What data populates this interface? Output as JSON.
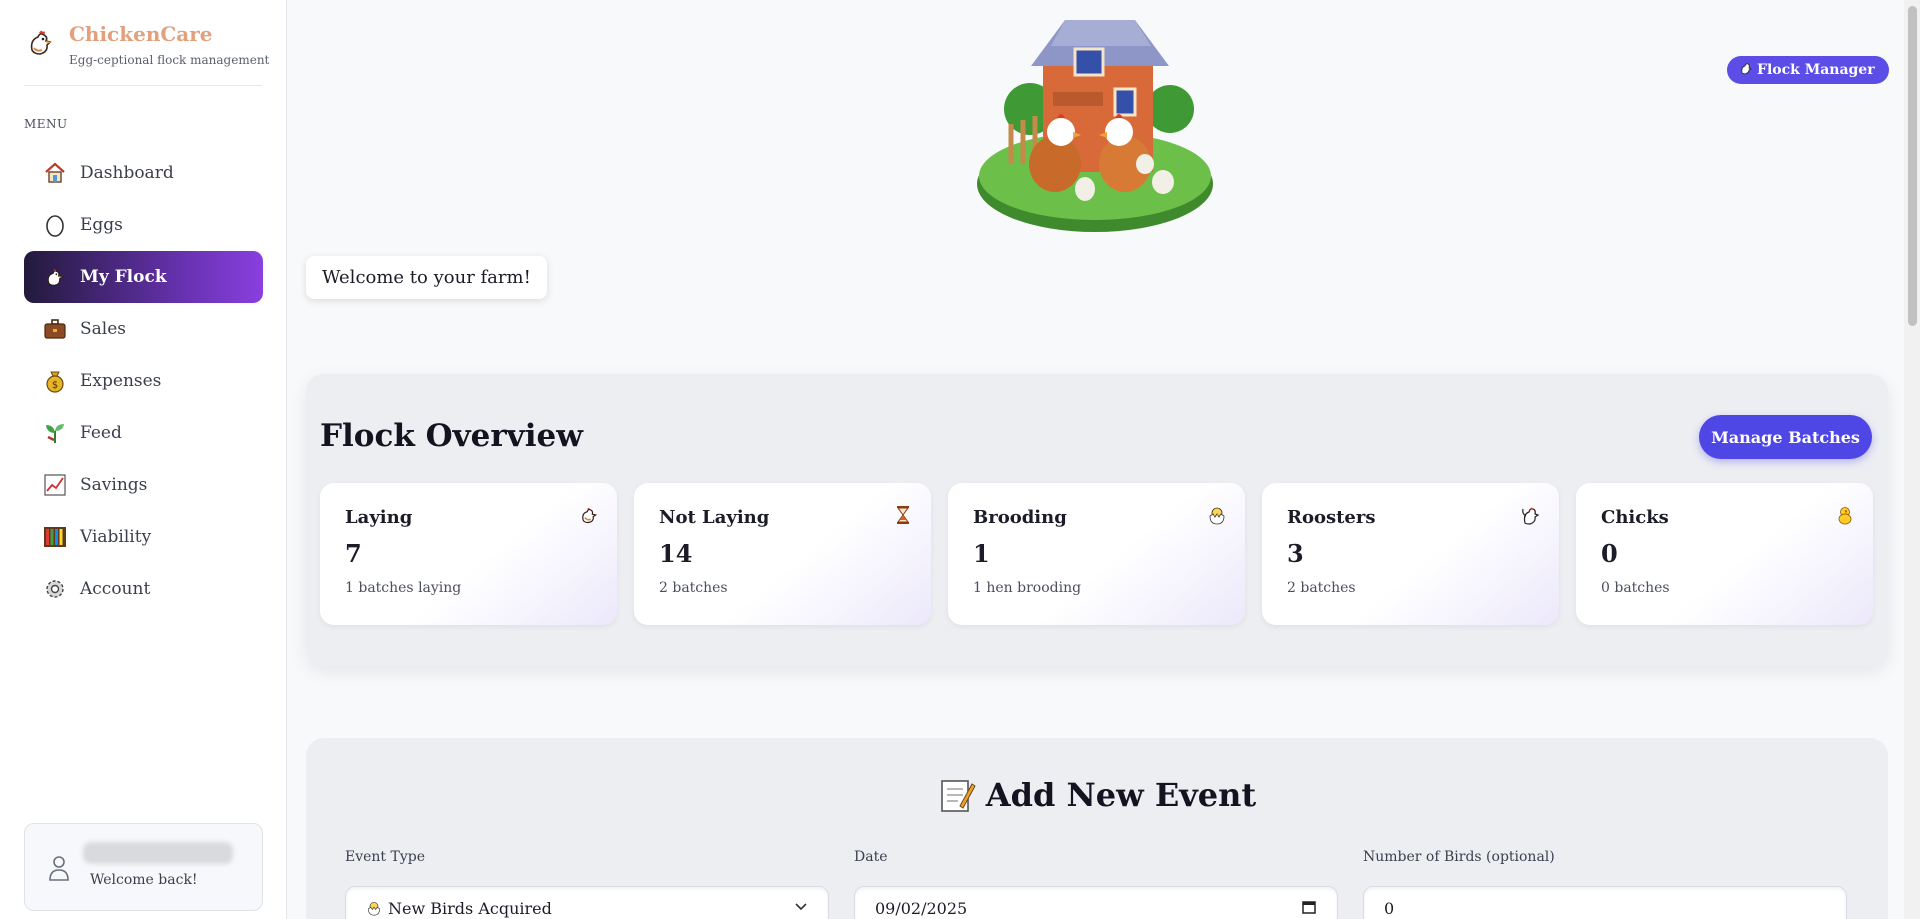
{
  "brand": {
    "name": "ChickenCare",
    "tagline": "Egg-ceptional flock management"
  },
  "sidebar": {
    "menu_label": "MENU",
    "items": [
      {
        "label": "Dashboard",
        "icon": "house-icon",
        "active": false
      },
      {
        "label": "Eggs",
        "icon": "egg-icon",
        "active": false
      },
      {
        "label": "My Flock",
        "icon": "chicken-icon",
        "active": true
      },
      {
        "label": "Sales",
        "icon": "briefcase-icon",
        "active": false
      },
      {
        "label": "Expenses",
        "icon": "money-bag-icon",
        "active": false
      },
      {
        "label": "Feed",
        "icon": "sprout-icon",
        "active": false
      },
      {
        "label": "Savings",
        "icon": "chart-icon",
        "active": false
      },
      {
        "label": "Viability",
        "icon": "abacus-icon",
        "active": false
      },
      {
        "label": "Account",
        "icon": "gear-icon",
        "active": false
      }
    ],
    "user": {
      "welcome": "Welcome back!"
    }
  },
  "header": {
    "role_badge": "Flock Manager",
    "welcome": "Welcome to your farm!"
  },
  "overview": {
    "title": "Flock Overview",
    "manage_button": "Manage Batches",
    "stats": [
      {
        "title": "Laying",
        "value": "7",
        "sub": "1 batches laying",
        "icon": "chicken-icon"
      },
      {
        "title": "Not Laying",
        "value": "14",
        "sub": "2 batches",
        "icon": "hourglass-icon"
      },
      {
        "title": "Brooding",
        "value": "1",
        "sub": "1 hen brooding",
        "icon": "hatching-chick-icon"
      },
      {
        "title": "Roosters",
        "value": "3",
        "sub": "2 batches",
        "icon": "rooster-icon"
      },
      {
        "title": "Chicks",
        "value": "0",
        "sub": "0 batches",
        "icon": "chick-icon"
      }
    ]
  },
  "event": {
    "title": "Add New Event",
    "event_type_label": "Event Type",
    "event_type_value": "New Birds Acquired",
    "date_label": "Date",
    "date_value": "09/02/2025",
    "birds_label": "Number of Birds (optional)",
    "birds_value": "0"
  },
  "colors": {
    "accent": "#4e46e5",
    "brand": "#e3a07d",
    "active_nav_start": "#221a3c",
    "active_nav_end": "#8a3fe0"
  }
}
